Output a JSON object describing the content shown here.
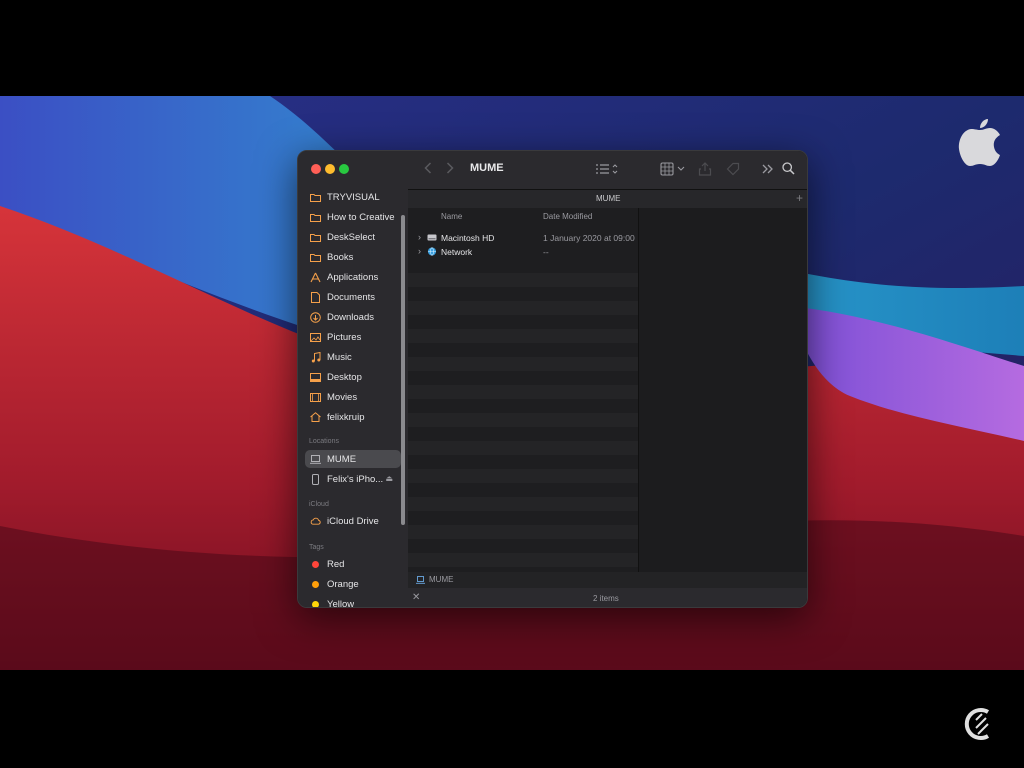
{
  "finder": {
    "title": "MUME",
    "path_title": "MUME",
    "favorites": [
      {
        "label": "TRYVISUAL",
        "icon": "folder-icon"
      },
      {
        "label": "How to Creative",
        "icon": "folder-icon"
      },
      {
        "label": "DeskSelect",
        "icon": "folder-icon"
      },
      {
        "label": "Books",
        "icon": "folder-icon"
      },
      {
        "label": "Applications",
        "icon": "applications-icon"
      },
      {
        "label": "Documents",
        "icon": "document-icon"
      },
      {
        "label": "Downloads",
        "icon": "download-icon"
      },
      {
        "label": "Pictures",
        "icon": "pictures-icon"
      },
      {
        "label": "Music",
        "icon": "music-icon"
      },
      {
        "label": "Desktop",
        "icon": "desktop-icon"
      },
      {
        "label": "Movies",
        "icon": "movies-icon"
      },
      {
        "label": "felixkruip",
        "icon": "home-icon"
      }
    ],
    "locations_header": "Locations",
    "locations": [
      {
        "label": "MUME",
        "icon": "laptop-icon",
        "selected": true
      },
      {
        "label": "Felix's iPho...",
        "icon": "iphone-icon",
        "eject": "⏏"
      }
    ],
    "icloud_header": "iCloud",
    "icloud": [
      {
        "label": "iCloud Drive",
        "icon": "cloud-icon"
      }
    ],
    "tags_header": "Tags",
    "tags": [
      {
        "label": "Red",
        "color": "#ff453a"
      },
      {
        "label": "Orange",
        "color": "#ff9f0a"
      },
      {
        "label": "Yellow",
        "color": "#ffd60a"
      }
    ],
    "columns": {
      "name": "Name",
      "date": "Date Modified"
    },
    "rows": [
      {
        "name": "Macintosh HD",
        "date": "1 January 2020 at 09:00",
        "icon": "hard-drive-icon"
      },
      {
        "name": "Network",
        "date": "--",
        "icon": "network-icon"
      }
    ],
    "breadcrumb": "MUME",
    "status": "2 items"
  },
  "colors": {
    "accent_orange": "#f5a04a",
    "sidebar_bg": "#2b2a2e",
    "window_bg": "#1e1e20"
  }
}
